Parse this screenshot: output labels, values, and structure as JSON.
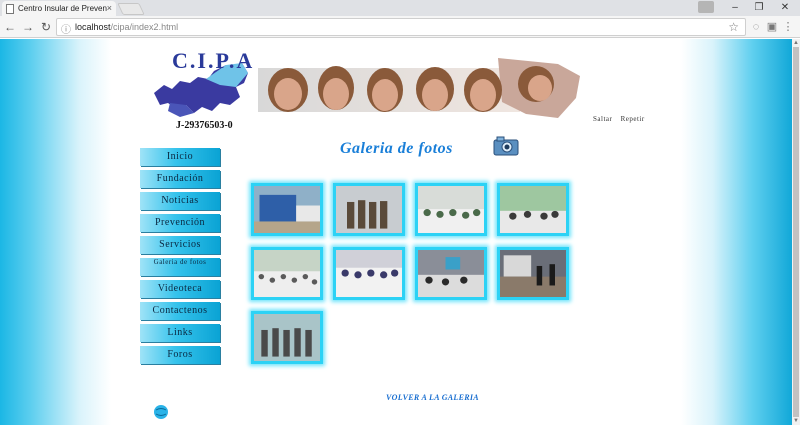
{
  "browser": {
    "tab_title": "Centro Insular de Preven",
    "tab_close": "×",
    "url_host": "localhost",
    "url_path": "/cipa/index2.html"
  },
  "header": {
    "logo_text": "C.I.P.A",
    "rif": "J-29376503-0",
    "links": [
      "Saltar",
      "Repetir"
    ]
  },
  "sidebar": {
    "items": [
      {
        "label": "Inicio"
      },
      {
        "label": "Fundación"
      },
      {
        "label": "Noticias"
      },
      {
        "label": "Prevención"
      },
      {
        "label": "Servicios"
      },
      {
        "label": "Galeria de fotos"
      },
      {
        "label": "Videoteca"
      },
      {
        "label": "Contactenos"
      },
      {
        "label": "Links"
      },
      {
        "label": "Foros"
      }
    ]
  },
  "gallery": {
    "title": "Galeria de fotos",
    "back_link": "VOLVER A LA GALERIA",
    "photo_count": 9
  },
  "colors": {
    "accent": "#1a7fd8",
    "thumb_border": "#2cd2f5",
    "nav_gradient_start": "#9fe3f7",
    "nav_gradient_end": "#0aa3d4"
  },
  "icons": [
    "back-arrow-icon",
    "forward-arrow-icon",
    "reload-icon",
    "page-icon",
    "star-icon",
    "camera-icon",
    "globe-icon"
  ]
}
